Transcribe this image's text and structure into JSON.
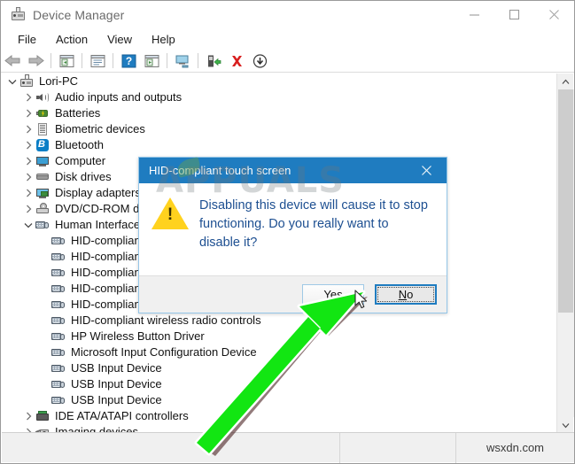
{
  "window": {
    "title": "Device Manager",
    "icon": "device-manager-icon",
    "buttons": {
      "minimize": "minimize-icon",
      "maximize": "maximize-icon",
      "close": "close-icon"
    }
  },
  "menubar": {
    "items": [
      {
        "label": "File"
      },
      {
        "label": "Action"
      },
      {
        "label": "View"
      },
      {
        "label": "Help"
      }
    ]
  },
  "toolbar": {
    "items": [
      {
        "name": "back-icon"
      },
      {
        "name": "forward-icon"
      },
      {
        "name": "separator"
      },
      {
        "name": "show-hide-console-tree-icon"
      },
      {
        "name": "separator"
      },
      {
        "name": "properties-icon"
      },
      {
        "name": "separator"
      },
      {
        "name": "help-icon"
      },
      {
        "name": "scan-for-hardware-changes-icon"
      },
      {
        "name": "separator"
      },
      {
        "name": "update-driver-icon"
      },
      {
        "name": "separator"
      },
      {
        "name": "enable-device-icon"
      },
      {
        "name": "uninstall-device-icon"
      },
      {
        "name": "disable-device-icon"
      }
    ]
  },
  "tree": {
    "items": [
      {
        "label": "Lori-PC",
        "indent": 0,
        "chevron": "down",
        "icon": "computer-root-icon"
      },
      {
        "label": "Audio inputs and outputs",
        "indent": 1,
        "chevron": "right",
        "icon": "speaker-icon"
      },
      {
        "label": "Batteries",
        "indent": 1,
        "chevron": "right",
        "icon": "battery-icon"
      },
      {
        "label": "Biometric devices",
        "indent": 1,
        "chevron": "right",
        "icon": "fingerprint-icon"
      },
      {
        "label": "Bluetooth",
        "indent": 1,
        "chevron": "right",
        "icon": "bluetooth-icon"
      },
      {
        "label": "Computer",
        "indent": 1,
        "chevron": "right",
        "icon": "monitor-icon"
      },
      {
        "label": "Disk drives",
        "indent": 1,
        "chevron": "right",
        "icon": "disk-drive-icon"
      },
      {
        "label": "Display adapters",
        "indent": 1,
        "chevron": "right",
        "icon": "display-adapter-icon"
      },
      {
        "label": "DVD/CD-ROM drives",
        "indent": 1,
        "chevron": "right",
        "icon": "dvd-drive-icon"
      },
      {
        "label": "Human Interface Devices",
        "indent": 1,
        "chevron": "down",
        "icon": "hid-icon"
      },
      {
        "label": "HID-compliant consumer control device",
        "indent": 2,
        "chevron": "none",
        "icon": "hid-icon"
      },
      {
        "label": "HID-compliant device",
        "indent": 2,
        "chevron": "none",
        "icon": "hid-icon"
      },
      {
        "label": "HID-compliant device",
        "indent": 2,
        "chevron": "none",
        "icon": "hid-icon"
      },
      {
        "label": "HID-compliant system controller",
        "indent": 2,
        "chevron": "none",
        "icon": "hid-icon"
      },
      {
        "label": "HID-compliant touch screen",
        "indent": 2,
        "chevron": "none",
        "icon": "hid-icon"
      },
      {
        "label": "HID-compliant wireless radio controls",
        "indent": 2,
        "chevron": "none",
        "icon": "hid-icon"
      },
      {
        "label": "HP Wireless Button Driver",
        "indent": 2,
        "chevron": "none",
        "icon": "hid-icon"
      },
      {
        "label": "Microsoft Input Configuration Device",
        "indent": 2,
        "chevron": "none",
        "icon": "hid-icon"
      },
      {
        "label": "USB Input Device",
        "indent": 2,
        "chevron": "none",
        "icon": "hid-icon"
      },
      {
        "label": "USB Input Device",
        "indent": 2,
        "chevron": "none",
        "icon": "hid-icon"
      },
      {
        "label": "USB Input Device",
        "indent": 2,
        "chevron": "none",
        "icon": "hid-icon"
      },
      {
        "label": "IDE ATA/ATAPI controllers",
        "indent": 1,
        "chevron": "right",
        "icon": "ide-controller-icon"
      },
      {
        "label": "Imaging devices",
        "indent": 1,
        "chevron": "right",
        "icon": "imaging-device-icon"
      }
    ]
  },
  "dialog": {
    "title": "HID-compliant touch screen",
    "close_icon": "close-icon",
    "warning_icon": "warning-triangle-icon",
    "message": "Disabling this device will cause it to stop functioning. Do you really want to disable it?",
    "buttons": {
      "yes": "Yes",
      "yes_accel": "Y",
      "no": "No",
      "no_accel": "N"
    }
  },
  "annotations": {
    "arrow": "green-arrow-pointing-to-yes-button",
    "cursor": "mouse-pointer"
  },
  "watermarks": {
    "appuals": "APPUALS",
    "wsxdn": "wsxdn.com"
  },
  "scrollbar": {
    "up_arrow": "scroll-up-icon",
    "down_arrow": "scroll-down-icon"
  },
  "colors": {
    "dialog_title_bg": "#1f7cc0",
    "dialog_text": "#1d4f91",
    "warning_yellow": "#ffd21e",
    "arrow_green": "#1fe01f",
    "focus_blue": "#1f7cc0"
  }
}
